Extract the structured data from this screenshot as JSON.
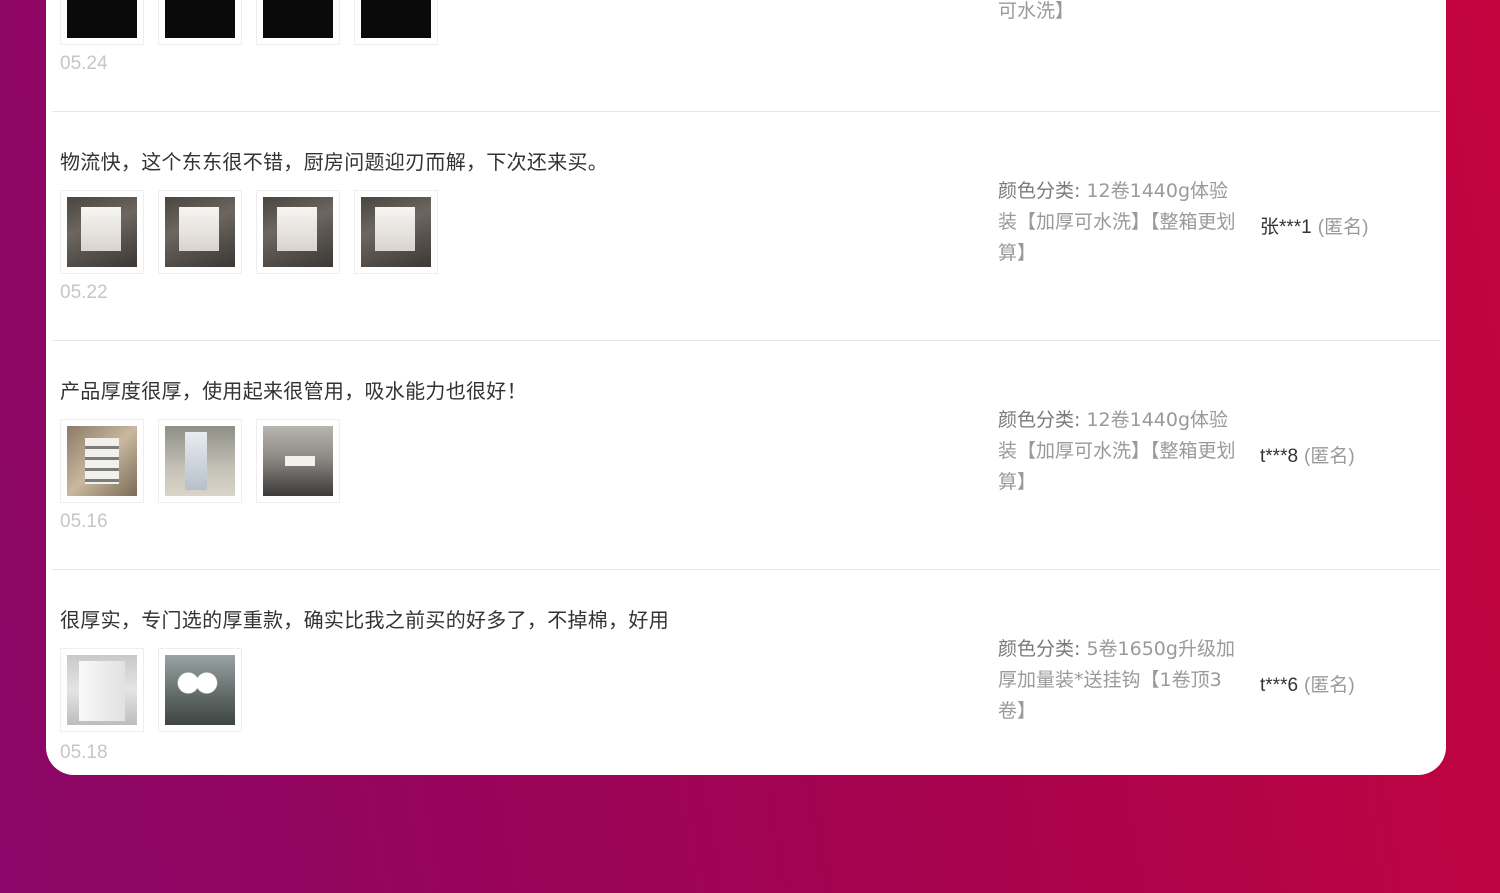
{
  "reviews": [
    {
      "text": "",
      "date": "05.24",
      "thumbs": [
        "dark-photo",
        "dark-photo",
        "dark-photo",
        "dark-photo"
      ],
      "sku_line": "可水洗】",
      "user": "",
      "anon": ""
    },
    {
      "text": "物流快，这个东东很不错，厨房问题迎刃而解，下次还来买。",
      "date": "05.22",
      "thumbs": [
        "box-photo",
        "box-photo",
        "box-photo",
        "box-photo"
      ],
      "sku_label": "颜色分类:",
      "sku_value": " 12卷1440g体验装【加厚可水洗】【整箱更划算】",
      "user": "张***1",
      "anon": "(匿名)"
    },
    {
      "text": "产品厚度很厚，使用起来很管用，吸水能力也很好！",
      "date": "05.16",
      "thumbs": [
        "rolls-photo",
        "table-photo",
        "tile-photo"
      ],
      "sku_label": "颜色分类:",
      "sku_value": " 12卷1440g体验装【加厚可水洗】【整箱更划算】",
      "user": "t***8",
      "anon": "(匿名)"
    },
    {
      "text": "很厚实，专门选的厚重款，确实比我之前买的好多了，不掉棉，好用",
      "date": "05.18",
      "thumbs": [
        "towel-photo",
        "counter-photo"
      ],
      "sku_label": "颜色分类:",
      "sku_value": " 5卷1650g升级加厚加量装*送挂钩【1卷顶3卷】",
      "user": "t***6",
      "anon": "(匿名)"
    }
  ],
  "colors": {
    "background_start": "#8a0668",
    "background_end": "#c4043f",
    "card": "#ffffff",
    "date_text": "#c6c6c6",
    "sku_text": "#9a9a9a"
  }
}
